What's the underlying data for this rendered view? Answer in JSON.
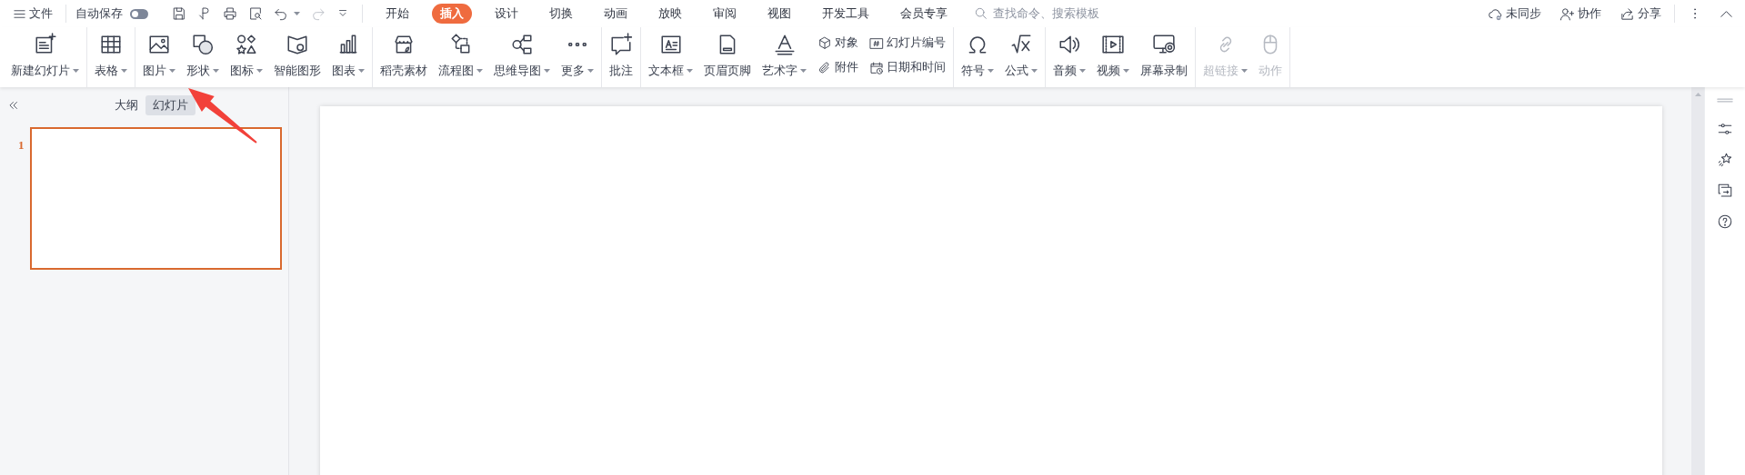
{
  "file_menu": {
    "label": "文件"
  },
  "autosave": {
    "label": "自动保存",
    "on": false
  },
  "undo": {
    "disabled": false
  },
  "redo": {
    "disabled": true
  },
  "tabs": [
    {
      "label": "开始",
      "selected": false
    },
    {
      "label": "插入",
      "selected": true
    },
    {
      "label": "设计",
      "selected": false
    },
    {
      "label": "切换",
      "selected": false
    },
    {
      "label": "动画",
      "selected": false
    },
    {
      "label": "放映",
      "selected": false
    },
    {
      "label": "审阅",
      "selected": false
    },
    {
      "label": "视图",
      "selected": false
    },
    {
      "label": "开发工具",
      "selected": false
    },
    {
      "label": "会员专享",
      "selected": false
    }
  ],
  "search": {
    "placeholder": "查找命令、搜索模板"
  },
  "account_actions": [
    {
      "label": "未同步"
    },
    {
      "label": "协作"
    },
    {
      "label": "分享"
    }
  ],
  "ribbon": {
    "groups": [
      {
        "items": [
          {
            "kind": "large",
            "label": "新建幻灯片",
            "dropdown": true,
            "disabled": false
          }
        ]
      },
      {
        "items": [
          {
            "kind": "large",
            "label": "表格",
            "dropdown": true,
            "disabled": false
          }
        ]
      },
      {
        "items": [
          {
            "kind": "large",
            "label": "图片",
            "dropdown": true,
            "disabled": false
          },
          {
            "kind": "large",
            "label": "形状",
            "dropdown": true,
            "disabled": false
          },
          {
            "kind": "large",
            "label": "图标",
            "dropdown": true,
            "disabled": false
          },
          {
            "kind": "large",
            "label": "智能图形",
            "dropdown": false,
            "disabled": false
          },
          {
            "kind": "large",
            "label": "图表",
            "dropdown": true,
            "disabled": false
          }
        ]
      },
      {
        "items": [
          {
            "kind": "large",
            "label": "稻壳素材",
            "dropdown": false,
            "disabled": false
          },
          {
            "kind": "large",
            "label": "流程图",
            "dropdown": true,
            "disabled": false
          },
          {
            "kind": "large",
            "label": "思维导图",
            "dropdown": true,
            "disabled": false
          },
          {
            "kind": "large",
            "label": "更多",
            "dropdown": true,
            "disabled": false
          }
        ]
      },
      {
        "items": [
          {
            "kind": "large",
            "label": "批注",
            "dropdown": false,
            "disabled": false
          }
        ]
      },
      {
        "items": [
          {
            "kind": "large",
            "label": "文本框",
            "dropdown": true,
            "disabled": false
          },
          {
            "kind": "large",
            "label": "页眉页脚",
            "dropdown": false,
            "disabled": false
          },
          {
            "kind": "large",
            "label": "艺术字",
            "dropdown": true,
            "disabled": false
          },
          {
            "kind": "stack",
            "entries": [
              {
                "label": "对象"
              },
              {
                "label": "附件"
              }
            ]
          },
          {
            "kind": "stack",
            "entries": [
              {
                "label": "幻灯片编号"
              },
              {
                "label": "日期和时间"
              }
            ]
          }
        ]
      },
      {
        "items": [
          {
            "kind": "large",
            "label": "符号",
            "dropdown": true,
            "disabled": false
          },
          {
            "kind": "large",
            "label": "公式",
            "dropdown": true,
            "disabled": false
          }
        ]
      },
      {
        "items": [
          {
            "kind": "large",
            "label": "音频",
            "dropdown": true,
            "disabled": false
          },
          {
            "kind": "large",
            "label": "视频",
            "dropdown": true,
            "disabled": false
          },
          {
            "kind": "large",
            "label": "屏幕录制",
            "dropdown": false,
            "disabled": false
          }
        ]
      },
      {
        "items": [
          {
            "kind": "large",
            "label": "超链接",
            "dropdown": true,
            "disabled": true
          },
          {
            "kind": "large",
            "label": "动作",
            "dropdown": false,
            "disabled": true
          }
        ]
      }
    ]
  },
  "slide_panel": {
    "tabs": [
      {
        "label": "大纲",
        "selected": false
      },
      {
        "label": "幻灯片",
        "selected": true
      }
    ],
    "slides": [
      {
        "number": "1",
        "selected": true
      }
    ]
  }
}
